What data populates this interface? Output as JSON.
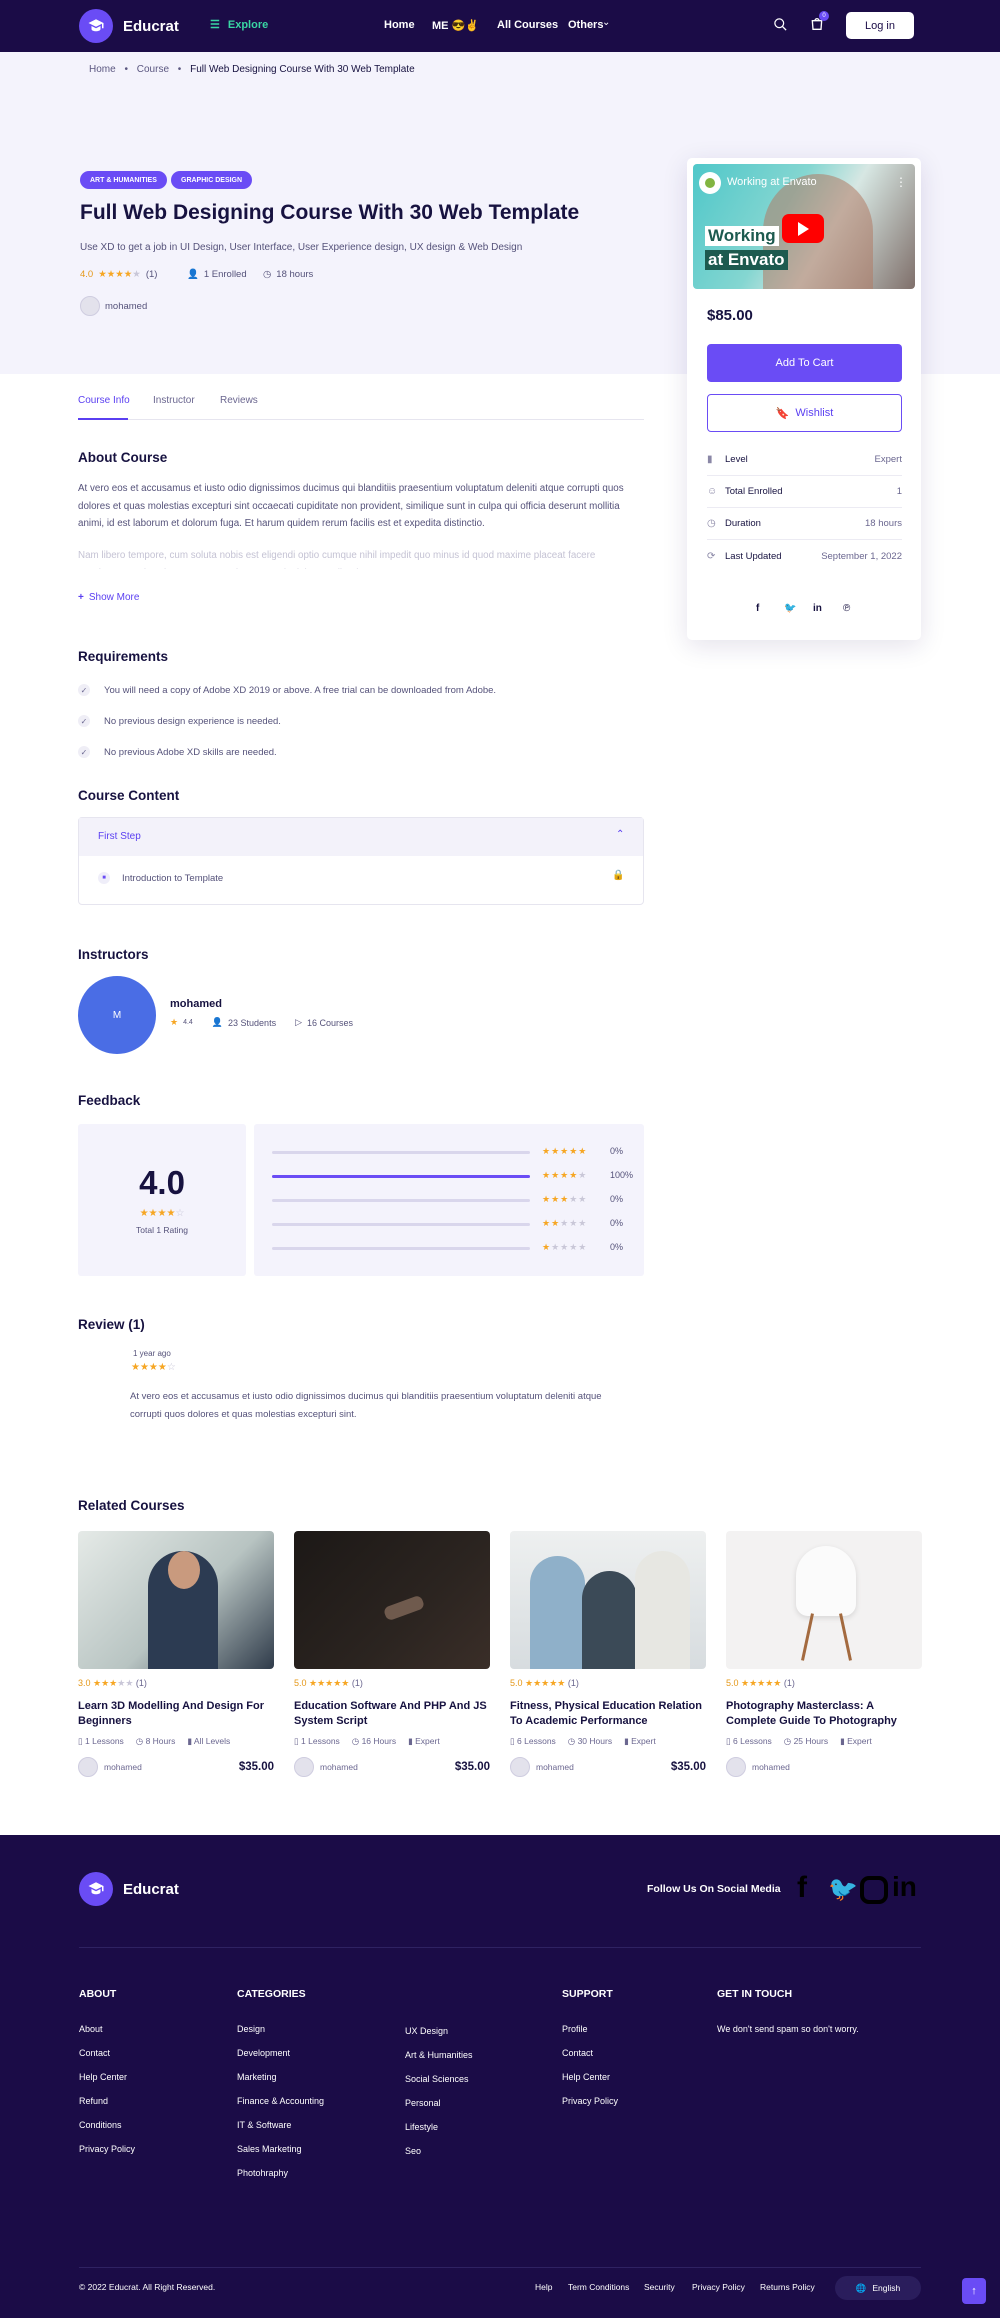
{
  "header": {
    "brand": "Educrat",
    "explore": "Explore",
    "nav": [
      "Home",
      "ME 😎✌",
      "All Courses",
      "Others"
    ],
    "cart_count": "0",
    "login": "Log in"
  },
  "breadcrumb": [
    "Home",
    "Course",
    "Full Web Designing Course With 30 Web Template"
  ],
  "course": {
    "categories": [
      "ART & HUMANITIES",
      "GRAPHIC DESIGN"
    ],
    "title": "Full Web Designing Course With 30 Web Template",
    "subtitle": "Use XD to get a job in UI Design, User Interface, User Experience design, UX design & Web Design",
    "rating": "4.0",
    "rating_count": "(1)",
    "enrolled": "1 Enrolled",
    "hours": "18 hours",
    "author": "mohamed"
  },
  "tabs": [
    "Course Info",
    "Instructor",
    "Reviews"
  ],
  "about": {
    "heading": "About Course",
    "text": "At vero eos et accusamus et iusto odio dignissimos ducimus qui blanditiis praesentium voluptatum deleniti atque corrupti quos dolores et quas molestias excepturi sint occaecati cupiditate non provident, similique sunt in culpa qui officia deserunt mollitia animi, id est laborum et dolorum fuga. Et harum quidem rerum facilis est et expedita distinctio.",
    "faded": "Nam libero tempore, cum soluta nobis est eligendi optio cumque nihil impedit quo minus id quod maxime placeat facere possimus, omnis voluptas assumenda est, omnis dolor repellendus.",
    "show_more": "Show More"
  },
  "requirements": {
    "heading": "Requirements",
    "items": [
      "You will need a copy of Adobe XD 2019 or above. A free trial can be downloaded from Adobe.",
      "No previous design experience is needed.",
      "No previous Adobe XD skills are needed."
    ]
  },
  "content": {
    "heading": "Course Content",
    "section": "First Step",
    "lesson": "Introduction to Template"
  },
  "instructors": {
    "heading": "Instructors",
    "initial": "M",
    "name": "mohamed",
    "rating": "4.4",
    "students": "23 Students",
    "courses": "16 Courses"
  },
  "feedback": {
    "heading": "Feedback",
    "score": "4.0",
    "total": "Total 1 Rating",
    "rows": [
      {
        "stars": 5,
        "fill": 0,
        "pct": "0%"
      },
      {
        "stars": 4,
        "fill": 1,
        "pct": "100%"
      },
      {
        "stars": 3,
        "fill": 0,
        "pct": "0%"
      },
      {
        "stars": 2,
        "fill": 0,
        "pct": "0%"
      },
      {
        "stars": 1,
        "fill": 0,
        "pct": "0%"
      }
    ]
  },
  "review": {
    "heading": "Review (1)",
    "time": "1 year ago",
    "text": "At vero eos et accusamus et iusto odio dignissimos ducimus qui blanditiis praesentium voluptatum deleniti atque corrupti quos dolores et quas molestias excepturi sint."
  },
  "sidebar": {
    "video_title": "Working at Envato",
    "video_caption_1": "Working",
    "video_caption_2": "at Envato",
    "price": "$85.00",
    "add_to_cart": "Add To Cart",
    "wishlist": "Wishlist",
    "info": [
      {
        "label": "Level",
        "value": "Expert"
      },
      {
        "label": "Total Enrolled",
        "value": "1"
      },
      {
        "label": "Duration",
        "value": "18 hours"
      },
      {
        "label": "Last Updated",
        "value": "September 1, 2022"
      }
    ]
  },
  "related": {
    "heading": "Related Courses",
    "items": [
      {
        "rating": "3.0",
        "count": "(1)",
        "title": "Learn 3D Modelling And Design For Beginners",
        "lessons": "1 Lessons",
        "hours": "8 Hours",
        "level": "All Levels",
        "author": "mohamed",
        "price": "$35.00"
      },
      {
        "rating": "5.0",
        "count": "(1)",
        "title": "Education Software And PHP And JS System Script",
        "lessons": "1 Lessons",
        "hours": "16 Hours",
        "level": "Expert",
        "author": "mohamed",
        "price": "$35.00"
      },
      {
        "rating": "5.0",
        "count": "(1)",
        "title": "Fitness, Physical Education Relation To Academic Performance",
        "lessons": "6 Lessons",
        "hours": "30 Hours",
        "level": "Expert",
        "author": "mohamed",
        "price": "$35.00"
      },
      {
        "rating": "5.0",
        "count": "(1)",
        "title": "Photography Masterclass: A Complete Guide To Photography",
        "lessons": "6 Lessons",
        "hours": "25 Hours",
        "level": "Expert",
        "author": "mohamed",
        "price": ""
      }
    ]
  },
  "footer": {
    "brand": "Educrat",
    "follow": "Follow Us On Social Media",
    "about_h": "ABOUT",
    "about": [
      "About",
      "Contact",
      "Help Center",
      "Refund",
      "Conditions",
      "Privacy Policy"
    ],
    "cat_h": "CATEGORIES",
    "cat1": [
      "Design",
      "Development",
      "Marketing",
      "Finance & Accounting",
      "IT & Software",
      "Sales Marketing",
      "Photohraphy"
    ],
    "cat2": [
      "UX Design",
      "Art & Humanities",
      "Social Sciences",
      "Personal",
      "Lifestyle",
      "Seo"
    ],
    "support_h": "SUPPORT",
    "support": [
      "Profile",
      "Contact",
      "Help Center",
      "Privacy Policy"
    ],
    "touch_h": "GET IN TOUCH",
    "touch": "We don't send spam so don't worry.",
    "copyright": "© 2022 Educrat. All Right Reserved.",
    "bottom_links": [
      "Help",
      "Term Conditions",
      "Security",
      "Privacy Policy",
      "Returns Policy"
    ],
    "language": "English"
  },
  "colors": {
    "brand": "#1b0c47",
    "accent": "#6a4cf5",
    "star": "#f6a623"
  }
}
